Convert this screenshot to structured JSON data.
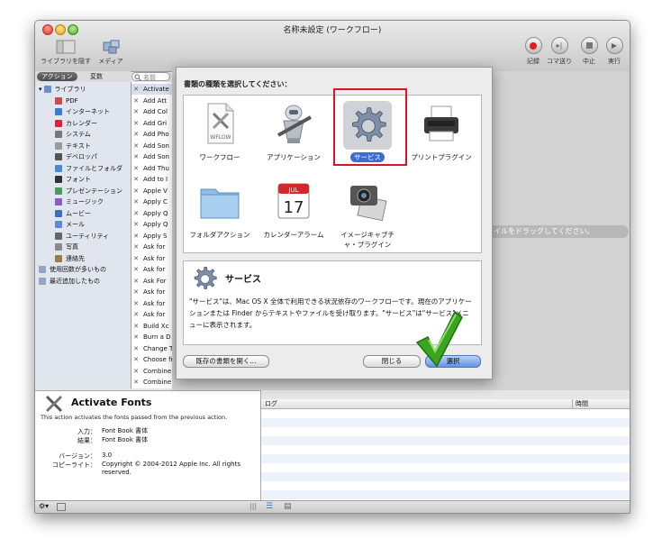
{
  "window": {
    "title": "名称未設定 (ワークフロー)"
  },
  "toolbar": {
    "hide_library": "ライブラリを隠す",
    "media": "メディア",
    "record": "記録",
    "step": "コマ送り",
    "stop": "中止",
    "run": "実行"
  },
  "library_tabs": {
    "actions": "アクション",
    "variables": "変数"
  },
  "search": {
    "placeholder": "名前"
  },
  "library": {
    "items": [
      {
        "label": "ライブラリ",
        "level": 0,
        "icon": "library-icon"
      },
      {
        "label": "PDF",
        "level": 1,
        "icon": "pdf-icon"
      },
      {
        "label": "インターネット",
        "level": 1,
        "icon": "internet-icon"
      },
      {
        "label": "カレンダー",
        "level": 1,
        "icon": "calendar-icon"
      },
      {
        "label": "システム",
        "level": 1,
        "icon": "system-icon"
      },
      {
        "label": "テキスト",
        "level": 1,
        "icon": "text-icon"
      },
      {
        "label": "デベロッパ",
        "level": 1,
        "icon": "developer-icon"
      },
      {
        "label": "ファイルとフォルダ",
        "level": 1,
        "icon": "finder-icon"
      },
      {
        "label": "フォント",
        "level": 1,
        "icon": "font-icon"
      },
      {
        "label": "プレゼンテーション",
        "level": 1,
        "icon": "presentation-icon"
      },
      {
        "label": "ミュージック",
        "level": 1,
        "icon": "music-icon"
      },
      {
        "label": "ムービー",
        "level": 1,
        "icon": "movie-icon"
      },
      {
        "label": "メール",
        "level": 1,
        "icon": "mail-icon"
      },
      {
        "label": "ユーティリティ",
        "level": 1,
        "icon": "utility-icon"
      },
      {
        "label": "写真",
        "level": 1,
        "icon": "photo-icon"
      },
      {
        "label": "連絡先",
        "level": 1,
        "icon": "contacts-icon"
      },
      {
        "label": "使用回数が多いもの",
        "level": 0,
        "icon": "folder-icon"
      },
      {
        "label": "最近追加したもの",
        "level": 0,
        "icon": "folder-icon"
      }
    ]
  },
  "actions": {
    "items": [
      "Activate",
      "Add Att",
      "Add Col",
      "Add Gri",
      "Add Pho",
      "Add Son",
      "Add Son",
      "Add Thu",
      "Add to I",
      "Apple V",
      "Apply C",
      "Apply Q",
      "Apply Q",
      "Apply S",
      "Ask for",
      "Ask for",
      "Ask for",
      "Ask For",
      "Ask for",
      "Ask for",
      "Ask for",
      "Build Xc",
      "Burn a D",
      "Change Type of Images",
      "Choose from List",
      "Combine PDF Pages",
      "Combine Text Files"
    ]
  },
  "workflow": {
    "drop_hint": "イルをドラッグしてください。"
  },
  "sheet": {
    "prompt": "書類の種類を選択してください：",
    "types": [
      {
        "label": "ワークフロー",
        "icon": "workflow-document-icon",
        "badge": "WFLOW"
      },
      {
        "label": "アプリケーション",
        "icon": "robot-application-icon"
      },
      {
        "label": "サービス",
        "icon": "gear-service-icon"
      },
      {
        "label": "プリントプラグイン",
        "icon": "printer-icon"
      },
      {
        "label": "フォルダアクション",
        "icon": "folder-action-icon"
      },
      {
        "label": "カレンダーアラーム",
        "icon": "calendar-alarm-icon",
        "badge": "JUL",
        "day": "17"
      },
      {
        "label": "イメージキャプチャ・プラグイン",
        "icon": "image-capture-icon"
      }
    ],
    "selected": "サービス",
    "info": {
      "title": "サービス",
      "text": "\"サービス\"は、Mac OS X 全体で利用できる状況依存のワークフローです。現在のアプリケーションまたは Finder からテキストやファイルを受け取ります。\"サービス\"は\"サービス\"メニューに表示されます。"
    },
    "buttons": {
      "open_existing": "既存の書類を開く...",
      "close": "閉じる",
      "choose": "選択"
    }
  },
  "description": {
    "title": "Activate Fonts",
    "text": "This action activates the fonts passed from the previous action.",
    "input_label": "入力：",
    "input_value": "Font Book 書体",
    "result_label": "結果：",
    "result_value": "Font Book 書体",
    "version_label": "バージョン：",
    "version_value": "3.0",
    "copyright_label": "コピーライト：",
    "copyright_value": "Copyright © 2004-2012 Apple Inc. All rights reserved."
  },
  "log": {
    "col_log": "ログ",
    "col_time": "時間"
  },
  "colors": {
    "selection_blue": "#3c6cd1",
    "highlight_red": "#e0141e",
    "checkmark_green": "#3aa51f"
  }
}
